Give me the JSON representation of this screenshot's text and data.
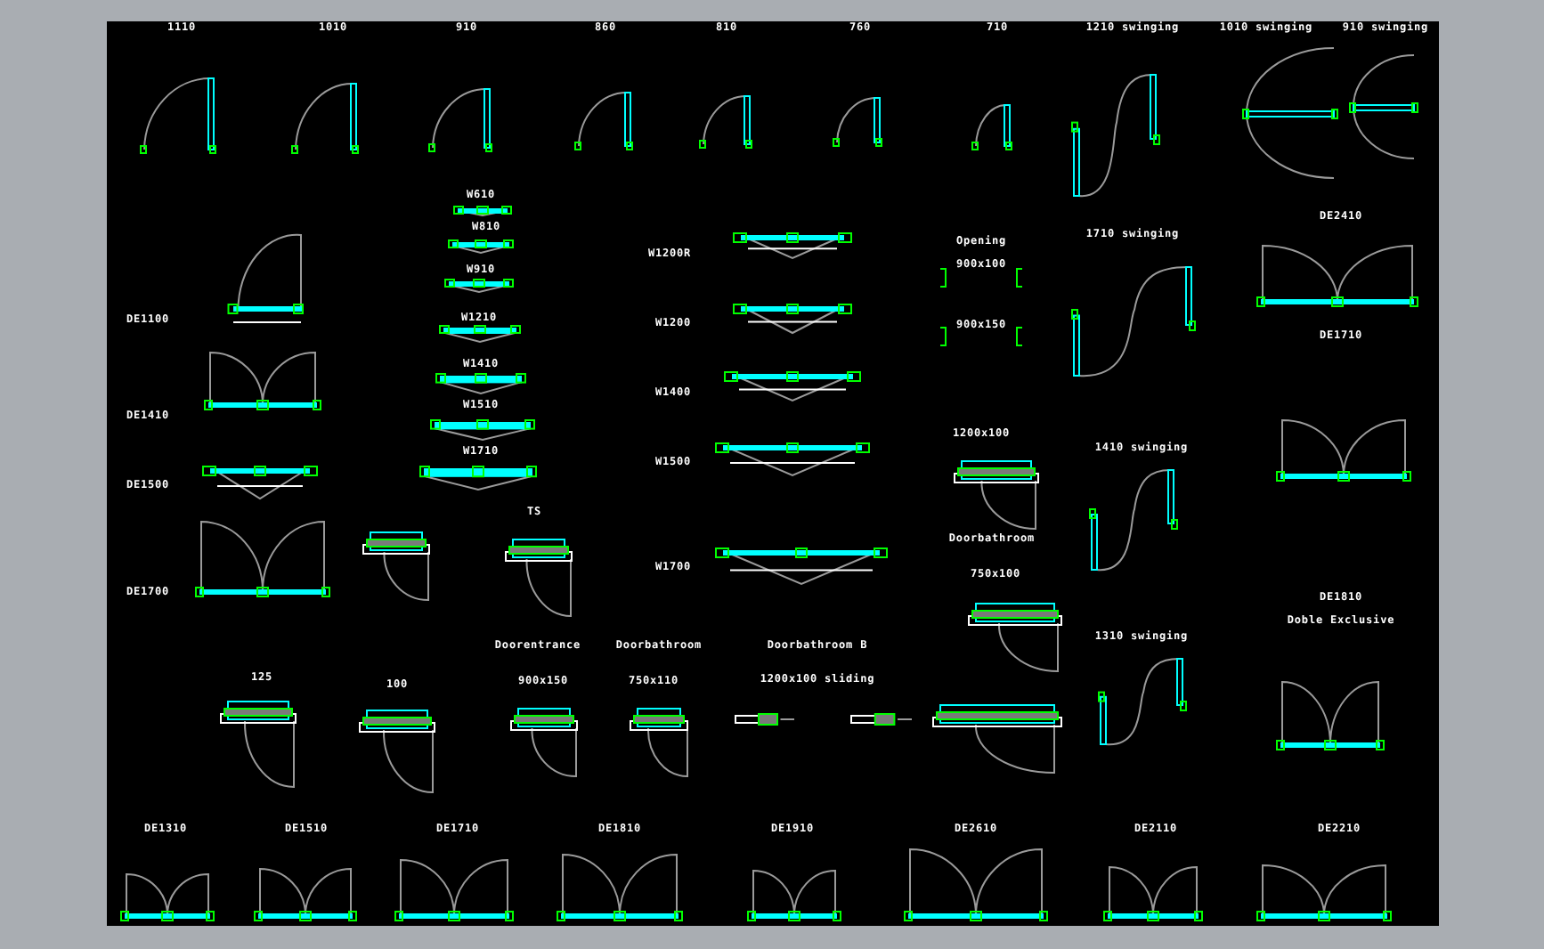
{
  "drawing": {
    "labels": [
      "1110",
      "1010",
      "910",
      "860",
      "810",
      "760",
      "710",
      "1210 swinging",
      "1010 swinging",
      "910 swinging",
      "W610",
      "W810",
      "W910",
      "W1210",
      "W1410",
      "W1510",
      "W1710",
      "DE1100",
      "DE1410",
      "DE1500",
      "DE1700",
      "TS",
      "W1200R",
      "W1200",
      "W1400",
      "W1500",
      "W1700",
      "Opening",
      "900x100",
      "900x150",
      "1200x100",
      "Doorbathroom",
      "750x100",
      "1710 swinging",
      "1410 swinging",
      "1310 swinging",
      "DE2410",
      "DE1710",
      "DE1810",
      "Doble Exclusive",
      "125",
      "100",
      "Doorentrance",
      "Doorbathroom",
      "900x150",
      "750x110",
      "Doorbathroom B",
      "1200x100 sliding",
      "DE1310",
      "DE1510",
      "DE1710",
      "DE1810",
      "DE1910",
      "DE2610",
      "DE2110",
      "DE2210"
    ]
  }
}
